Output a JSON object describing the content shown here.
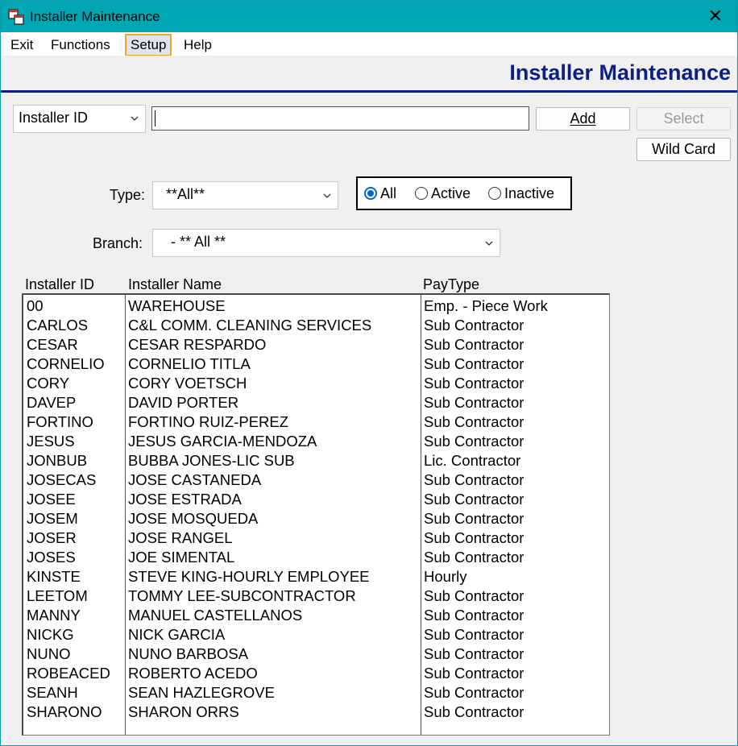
{
  "window": {
    "title": "Installer Maintenance"
  },
  "menu": {
    "items": [
      "Exit",
      "Functions",
      "Setup",
      "Help"
    ],
    "selected": "Setup"
  },
  "header": {
    "title": "Installer Maintenance"
  },
  "search": {
    "field_selector": "Installer ID",
    "value": ""
  },
  "buttons": {
    "add": "Add",
    "select": "Select",
    "wildcard": "Wild Card"
  },
  "filters": {
    "type_label": "Type:",
    "type_value": "**All**",
    "status_options": [
      "All",
      "Active",
      "Inactive"
    ],
    "status_selected": "All",
    "branch_label": "Branch:",
    "branch_value": "- ** All **"
  },
  "table": {
    "headers": [
      "Installer ID",
      "Installer Name",
      "PayType"
    ],
    "rows": [
      [
        "00",
        "WAREHOUSE",
        "Emp. - Piece Work"
      ],
      [
        "CARLOS",
        "C&L COMM. CLEANING SERVICES",
        "Sub Contractor"
      ],
      [
        "CESAR",
        "CESAR RESPARDO",
        "Sub Contractor"
      ],
      [
        "CORNELIO",
        "CORNELIO TITLA",
        "Sub Contractor"
      ],
      [
        "CORY",
        "CORY VOETSCH",
        "Sub Contractor"
      ],
      [
        "DAVEP",
        "DAVID PORTER",
        "Sub Contractor"
      ],
      [
        "FORTINO",
        "FORTINO RUIZ-PEREZ",
        "Sub Contractor"
      ],
      [
        "JESUS",
        "JESUS GARCIA-MENDOZA",
        "Sub Contractor"
      ],
      [
        "JONBUB",
        "BUBBA JONES-LIC SUB",
        "Lic. Contractor"
      ],
      [
        "JOSECAS",
        "JOSE CASTANEDA",
        "Sub Contractor"
      ],
      [
        "JOSEE",
        "JOSE ESTRADA",
        "Sub Contractor"
      ],
      [
        "JOSEM",
        "JOSE MOSQUEDA",
        "Sub Contractor"
      ],
      [
        "JOSER",
        "JOSE RANGEL",
        "Sub Contractor"
      ],
      [
        "JOSES",
        "JOE SIMENTAL",
        "Sub Contractor"
      ],
      [
        "KINSTE",
        "STEVE KING-HOURLY EMPLOYEE",
        "Hourly"
      ],
      [
        "LEETOM",
        "TOMMY LEE-SUBCONTRACTOR",
        "Sub Contractor"
      ],
      [
        "MANNY",
        "MANUEL CASTELLANOS",
        "Sub Contractor"
      ],
      [
        "NICKG",
        "NICK GARCIA",
        "Sub Contractor"
      ],
      [
        "NUNO",
        "NUNO BARBOSA",
        "Sub Contractor"
      ],
      [
        "ROBEACED",
        "ROBERTO ACEDO",
        "Sub Contractor"
      ],
      [
        "SEANH",
        "SEAN HAZLEGROVE",
        "Sub Contractor"
      ],
      [
        "SHARONO",
        "SHARON ORRS",
        "Sub Contractor"
      ]
    ]
  }
}
